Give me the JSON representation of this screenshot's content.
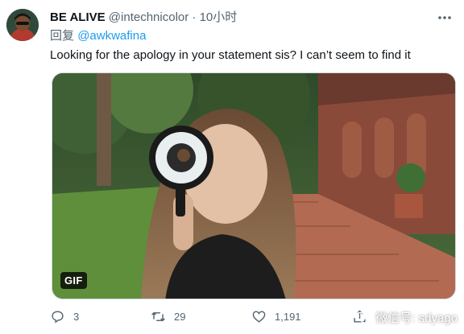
{
  "tweet": {
    "display_name": "BE ALIVE",
    "handle": "@intechnicolor",
    "separator": "·",
    "time": "10小时",
    "reply_prefix": "回复",
    "reply_to": "@awkwafina",
    "text": "Looking for the apology in your statement sis? I can’t seem to find it"
  },
  "media": {
    "badge": "GIF",
    "description_icon": "magnifying-glass-gif"
  },
  "actions": {
    "reply_count": "3",
    "retweet_count": "29",
    "like_count": "1,191"
  },
  "watermark": {
    "text": "微信号: sdyago"
  },
  "icons": {
    "more": "ellipsis-icon",
    "reply": "reply-icon",
    "retweet": "retweet-icon",
    "like": "heart-icon",
    "share": "share-icon",
    "wechat": "wechat-icon"
  },
  "colors": {
    "accent": "#1d9bf0",
    "secondary_text": "#536471",
    "primary_text": "#0f1419"
  }
}
